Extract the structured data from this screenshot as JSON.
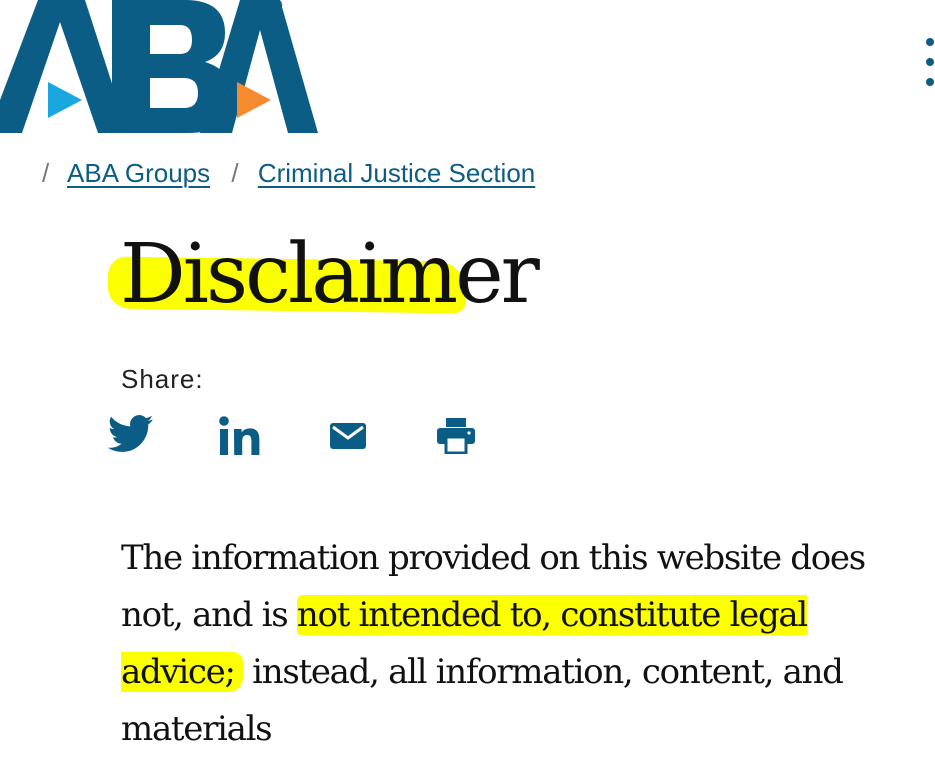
{
  "header": {
    "logo_text": "ABA",
    "registered_mark": "®",
    "menu_icon": "menu-dots-icon"
  },
  "breadcrumb": {
    "separator": "/",
    "items": [
      {
        "label": "ABA Groups"
      },
      {
        "label": "Criminal Justice Section"
      }
    ]
  },
  "page": {
    "title": "Disclaimer",
    "share_label": "Share:",
    "share_icons": [
      "twitter-icon",
      "linkedin-icon",
      "email-icon",
      "print-icon"
    ]
  },
  "body": {
    "part1": "The information provided on this website does not, and is ",
    "highlighted": "not intended to, constitute legal advice;",
    "part2": " instead, all information, content, and materials"
  },
  "colors": {
    "brand_blue": "#0b5d86",
    "accent_cyan": "#1aa7e0",
    "accent_orange": "#f58a2e",
    "highlight": "#fbff00"
  }
}
